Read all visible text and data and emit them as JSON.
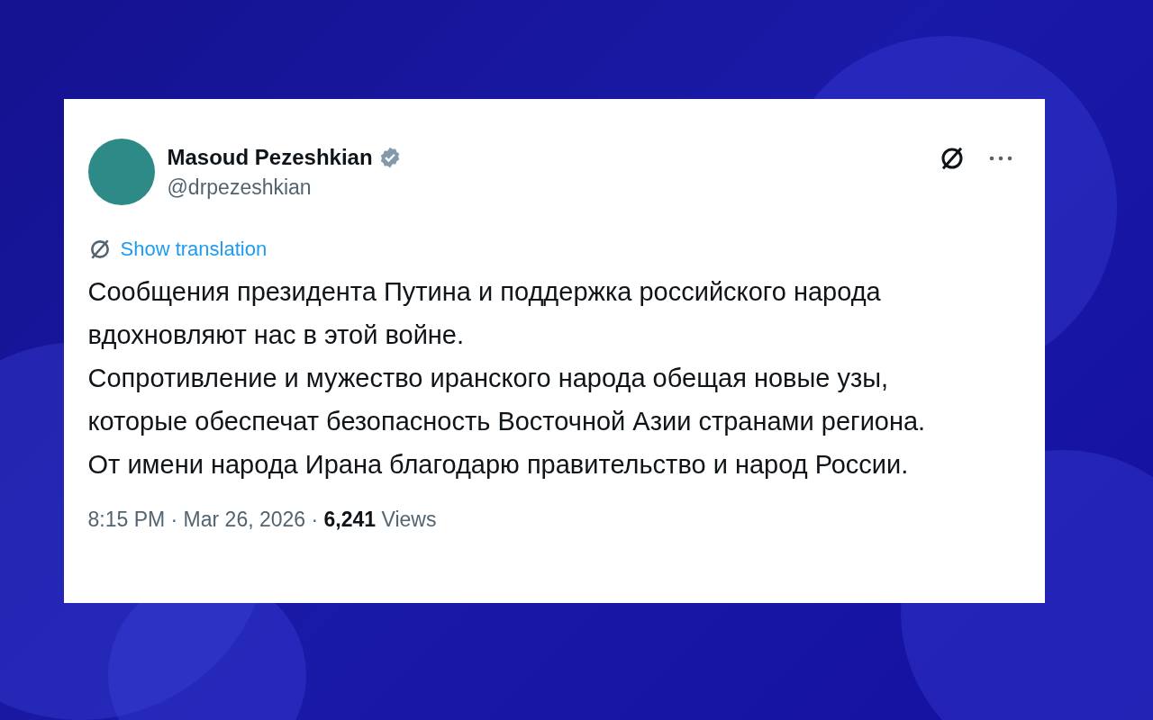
{
  "post": {
    "author": {
      "name": "Masoud Pezeshkian",
      "handle": "@drpezeshkian",
      "verified": true
    },
    "translate_link": "Show translation",
    "paragraphs": [
      "Сообщения президента Путина и поддержка российского народа вдохновляют нас в этой войне.",
      "Сопротивление и мужество иранского народа обещая новые узы, которые обеспечат безопасность Восточной Азии странами региона. От имени народа Ирана благодарю правительство и народ России."
    ],
    "meta": "8:15 PM · Mar 26, 2026 · **6,241** Views"
  }
}
